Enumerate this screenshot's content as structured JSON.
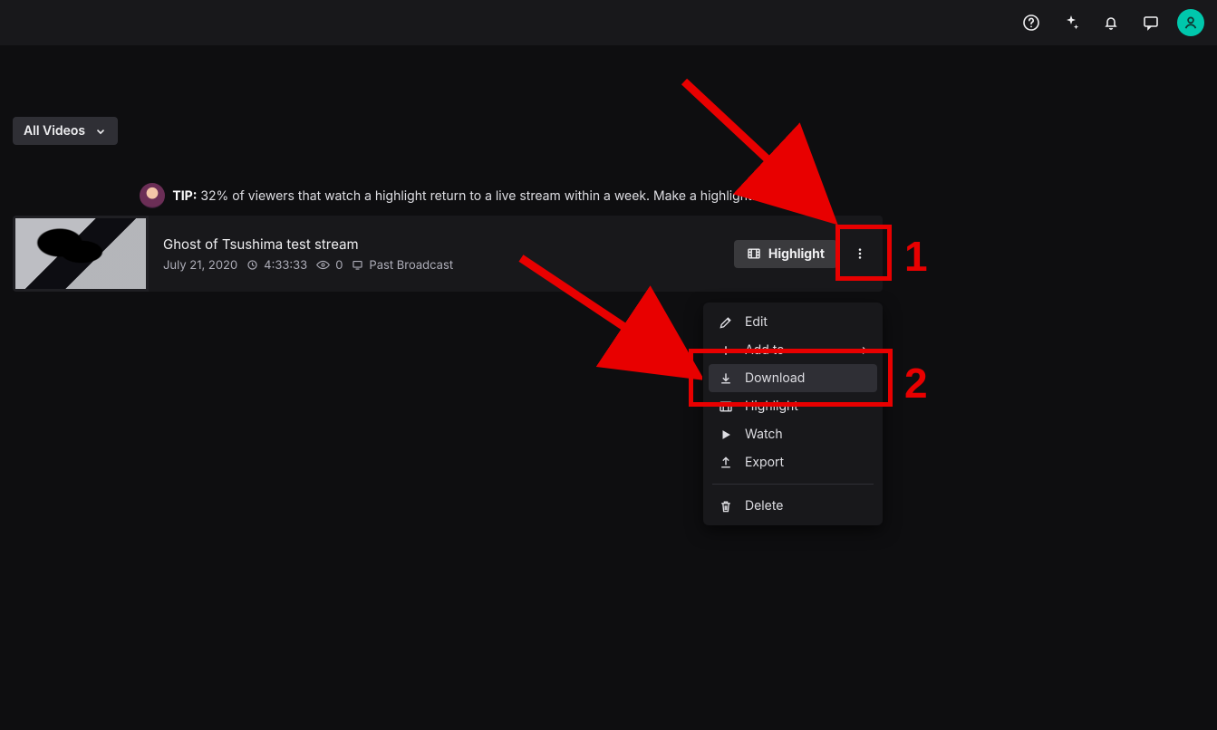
{
  "filter": {
    "label": "All Videos"
  },
  "tip": {
    "prefix": "TIP:",
    "text": "32% of viewers that watch a highlight return to a live stream within a week. Make a highlight."
  },
  "video": {
    "title": "Ghost of Tsushima test stream",
    "date": "July 21, 2020",
    "duration": "4:33:33",
    "views": "0",
    "type": "Past Broadcast",
    "highlight_label": "Highlight"
  },
  "menu": {
    "edit": "Edit",
    "add_to": "Add to",
    "download": "Download",
    "highlight": "Highlight",
    "watch": "Watch",
    "export": "Export",
    "delete": "Delete"
  },
  "callouts": {
    "one": "1",
    "two": "2"
  }
}
